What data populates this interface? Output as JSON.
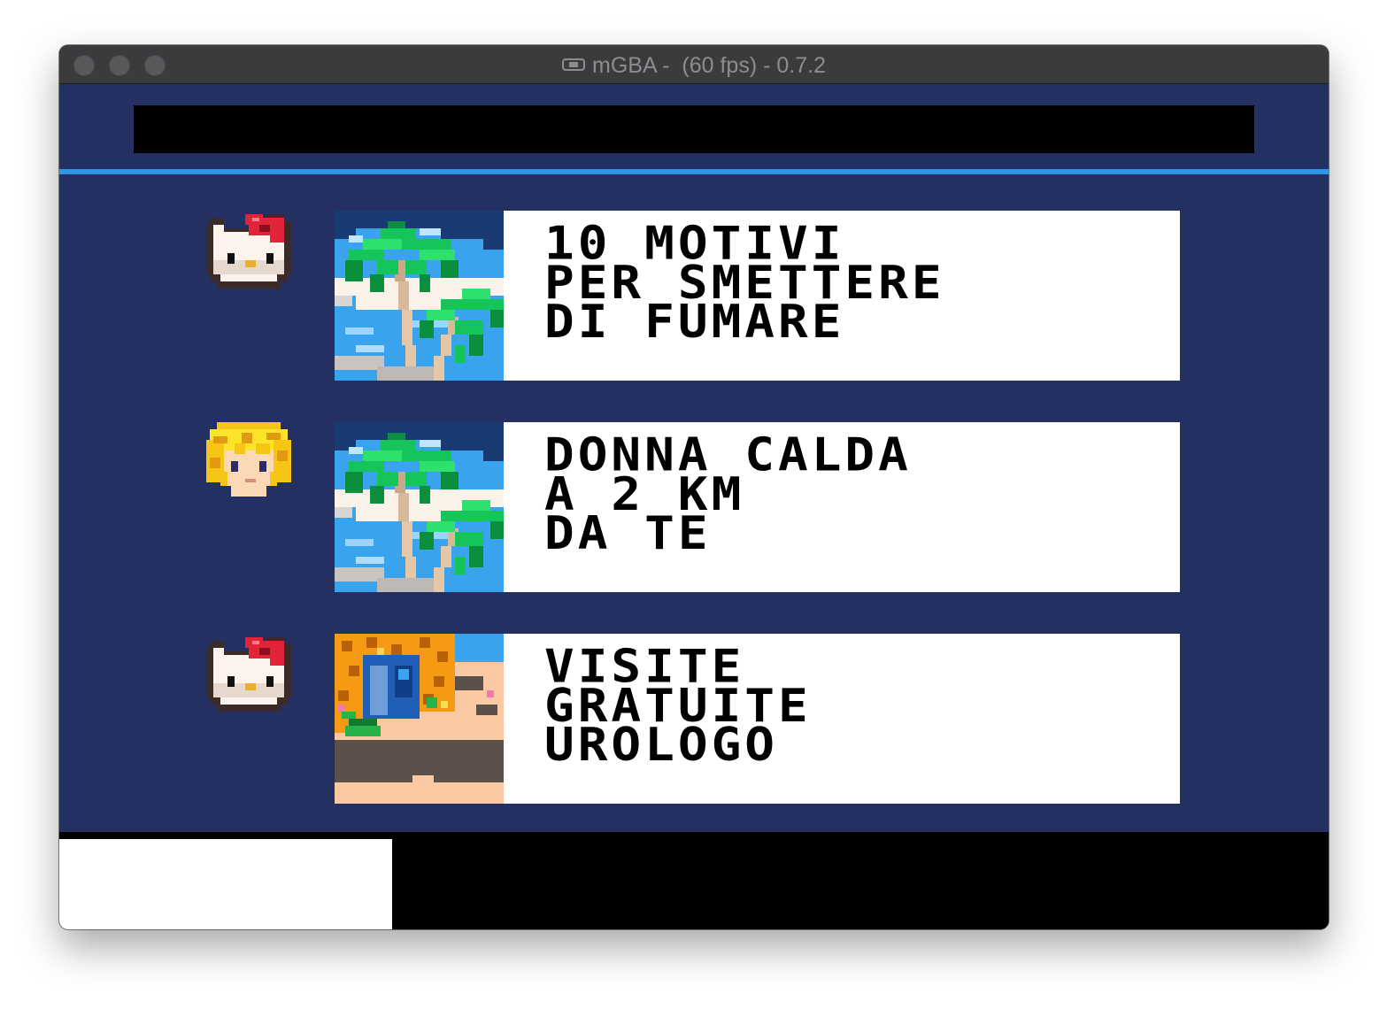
{
  "window": {
    "title": "mGBA -  (60 fps) - 0.7.2",
    "title_icon": "gamepad-icon"
  },
  "colors": {
    "screen_bg": "#233061",
    "divider": "#2e96e6",
    "card_bg": "#ffffff",
    "bars": "#000000"
  },
  "feed": {
    "posts": [
      {
        "avatar": "cat-face-with-red-bow-icon",
        "thumbnail": "palm-tree-beach",
        "headline": "10 MOTIVI\nPER SMETTERE\nDI FUMARE"
      },
      {
        "avatar": "blonde-curly-hair-face-icon",
        "thumbnail": "palm-tree-beach",
        "headline": "DONNA CALDA\nA 2 KM\nDA TE"
      },
      {
        "avatar": "cat-face-with-red-bow-icon",
        "thumbnail": "desert-cave-door",
        "headline": "VISITE\nGRATUITE\nUROLOGO"
      }
    ]
  }
}
